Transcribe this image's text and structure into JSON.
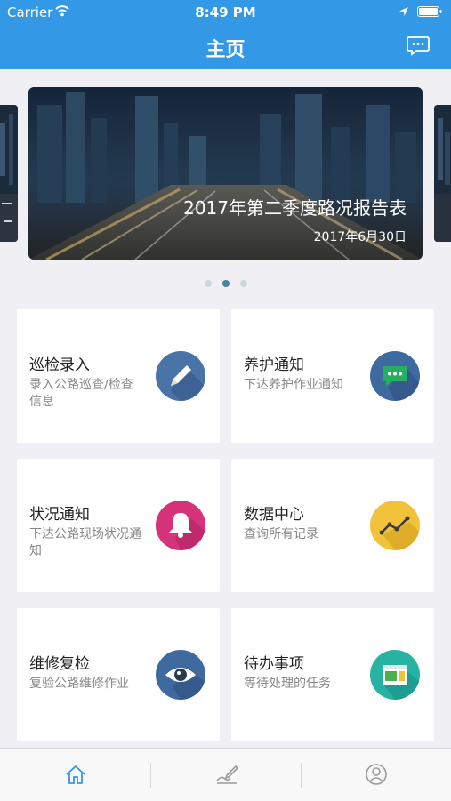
{
  "status_bar": {
    "carrier": "Carrier",
    "time": "8:49 PM"
  },
  "nav": {
    "title": "主页",
    "right_icon": "message-icon"
  },
  "banner": {
    "title": "2017年第二季度路况报告表",
    "date": "2017年6月30日",
    "page_count": 3,
    "active_page": 1
  },
  "grid": [
    {
      "title": "巡检录入",
      "desc": "录入公路巡查/检查信息",
      "icon": "pencil-icon",
      "icon_color": "#4a73a8"
    },
    {
      "title": "养护通知",
      "desc": "下达养护作业通知",
      "icon": "chat-bubble-icon",
      "icon_color": "#3e6aa0"
    },
    {
      "title": "状况通知",
      "desc": "下达公路现场状况通知",
      "icon": "bell-icon",
      "icon_color": "#d6337a"
    },
    {
      "title": "数据中心",
      "desc": "查询所有记录",
      "icon": "line-chart-icon",
      "icon_color": "#f2c23a"
    },
    {
      "title": "维修复检",
      "desc": "复验公路维修作业",
      "icon": "eye-icon",
      "icon_color": "#3e6aa0"
    },
    {
      "title": "待办事项",
      "desc": "等待处理的任务",
      "icon": "window-icon",
      "icon_color": "#26b3a3"
    }
  ],
  "tab_bar": {
    "items": [
      {
        "icon": "home-icon",
        "active": true
      },
      {
        "icon": "edit-sign-icon",
        "active": false
      },
      {
        "icon": "user-icon",
        "active": false
      }
    ],
    "active_color": "#3399e6",
    "inactive_color": "#9a9a9a"
  },
  "colors": {
    "primary": "#3399e6",
    "background": "#efeff4"
  }
}
